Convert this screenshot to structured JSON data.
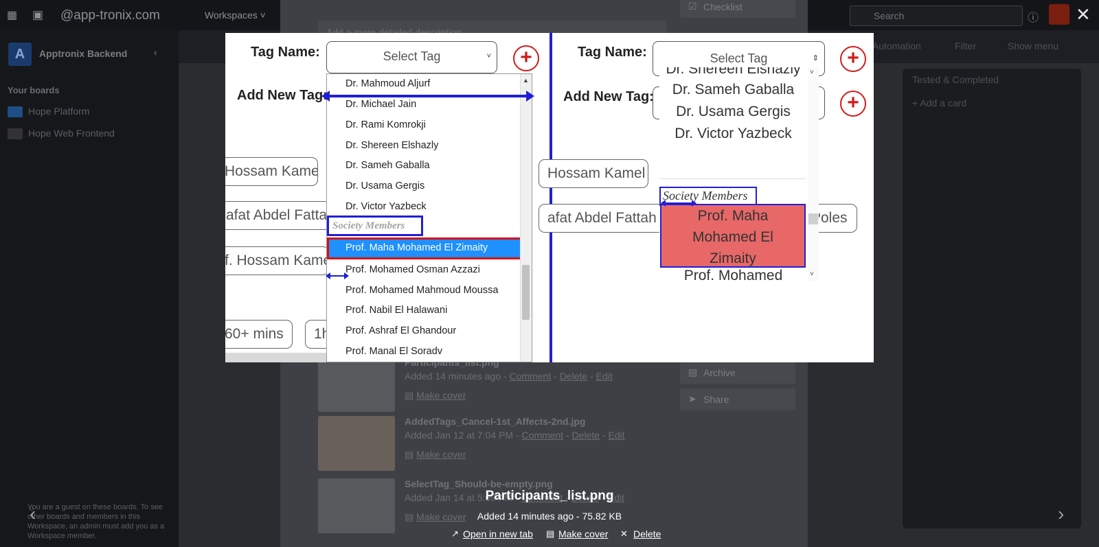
{
  "topbar": {
    "site": "@app-tronix.com",
    "workspaces": "Workspaces",
    "search_placeholder": "Search"
  },
  "sidebar": {
    "workspace_initial": "A",
    "workspace_name": "Apptronix Backend",
    "your_boards": "Your boards",
    "boards": [
      "Hope Platform",
      "Hope Web Frontend"
    ],
    "guest_note": "You are a guest on these boards. To see other boards and members in this Workspace, an admin must add you as a Workspace member."
  },
  "boardbar": {
    "automation": "Automation",
    "filter": "Filter",
    "show_menu": "Show menu"
  },
  "list": {
    "title": "Tested & Completed",
    "add_card": "Add a card"
  },
  "card_window": {
    "description_placeholder": "Add a more detailed description...",
    "checklist": "Checklist",
    "archive": "Archive",
    "share": "Share",
    "attachments": [
      {
        "name": "Participants_list.png",
        "meta_prefix": "Added 14 minutes ago - ",
        "comment": "Comment",
        "delete": "Delete",
        "edit": "Edit",
        "cover": "Make cover"
      },
      {
        "name": "AddedTags_Cancel-1st_Affects-2nd.jpg",
        "meta_prefix": "Added Jan 12 at 7:04 PM - ",
        "comment": "Comment",
        "delete": "Delete",
        "edit": "Edit",
        "cover": "Make cover"
      },
      {
        "name": "SelectTag_Should-be-empty.png",
        "meta_prefix": "Added Jan 14 at 5:09 AM - ",
        "comment": "Comment",
        "delete": "Delete",
        "edit": "Edit",
        "cover": "Make cover"
      }
    ]
  },
  "preview": {
    "left": {
      "tag_name_label": "Tag Name:",
      "add_new_tag_label": "Add New Tag:",
      "select_placeholder": "Select Tag",
      "chips": [
        "Hossam Kamel",
        "afat Abdel Fattah",
        "f. Hossam Kamel",
        "60+ mins",
        "1h"
      ],
      "options": [
        "Dr. Mahmoud Aljurf",
        "Dr. Michael Jain",
        "Dr. Rami Komrokji",
        "Dr. Shereen Elshazly",
        "Dr. Sameh Gaballa",
        "Dr. Usama Gergis",
        "Dr. Victor Yazbeck",
        "Prof. Mohamed Osman Azzazi",
        "Prof. Mohamed Mahmoud Moussa",
        "Prof. Nabil El Halawani",
        "Prof. Ashraf El Ghandour",
        "Prof. Manal El Soradv"
      ],
      "group_label": "Society Members",
      "selected_option": "Prof. Maha Mohamed El Zimaity"
    },
    "right": {
      "tag_name_label": "Tag Name:",
      "add_new_tag_label": "Add New Tag:",
      "select_placeholder": "Select Tag",
      "chips": [
        "Hossam Kamel",
        "afat Abdel Fattah",
        "Poles"
      ],
      "options": [
        "Dr. Shereen Elshazly",
        "Dr. Sameh Gaballa",
        "Dr. Usama Gergis",
        "Dr. Victor Yazbeck",
        "Prof. Mohamed"
      ],
      "group_label": "Society Members",
      "selected_lines": [
        "Prof. Maha",
        "Mohamed El",
        "Zimaity"
      ]
    }
  },
  "caption": {
    "filename": "Participants_list.png",
    "info": "Added 14 minutes ago - 75.82 KB",
    "open_new_tab": "Open in new tab",
    "make_cover": "Make cover",
    "delete": "Delete"
  },
  "colors": {
    "annotation_blue": "#1f1fd6",
    "annotation_red": "#e10b0b",
    "highlight_blue": "#1e90ff",
    "selected_red": "#e86868"
  }
}
